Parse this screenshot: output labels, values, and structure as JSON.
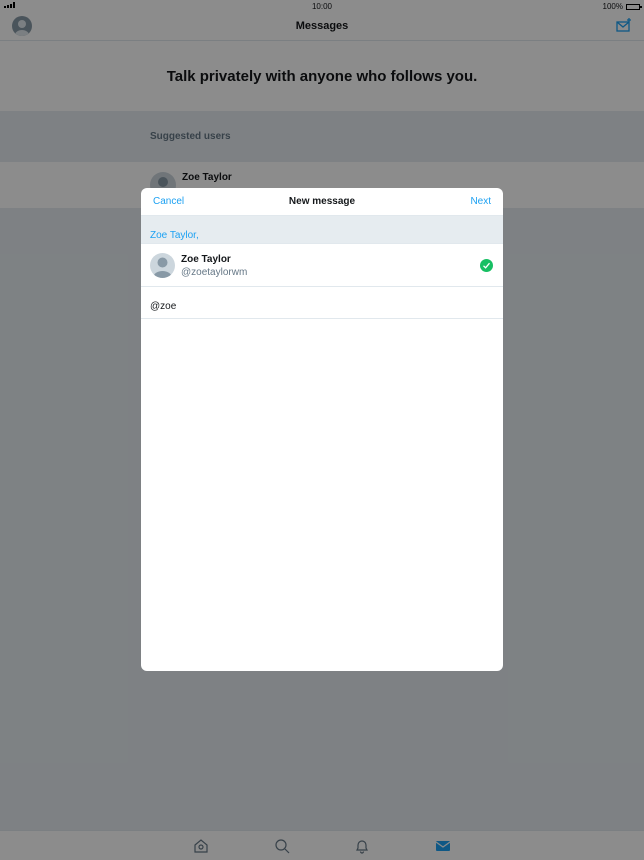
{
  "status_bar": {
    "time": "10:00",
    "battery": "100%"
  },
  "nav": {
    "title": "Messages"
  },
  "promo": {
    "text": "Talk privately with anyone who follows you."
  },
  "suggested": {
    "label": "Suggested users",
    "users": [
      {
        "name": "Zoe Taylor"
      }
    ]
  },
  "modal": {
    "cancel_label": "Cancel",
    "title": "New message",
    "next_label": "Next",
    "recipient_token": "Zoe Taylor,",
    "results": [
      {
        "name": "Zoe Taylor",
        "handle": "@zoetaylorwm",
        "selected": true
      }
    ],
    "search_value": "@zoe"
  },
  "tabs": [
    "home-icon",
    "search-icon",
    "bell-icon",
    "mail-icon"
  ],
  "colors": {
    "accent": "#1da1f2",
    "check": "#17bf63",
    "bg": "#e6ecf0"
  }
}
